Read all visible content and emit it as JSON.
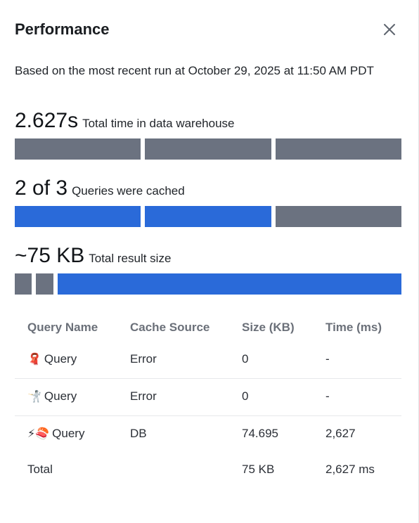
{
  "panel": {
    "title": "Performance",
    "close_icon": "close-icon"
  },
  "subtitle": "Based on the most recent run at October 29, 2025 at 11:50 AM PDT",
  "metrics": {
    "time": {
      "value": "2.627s",
      "label": "Total time in data warehouse",
      "segments": [
        "gray",
        "gray",
        "gray"
      ]
    },
    "cached": {
      "value": "2 of 3",
      "label": "Queries were cached",
      "segments": [
        "blue",
        "blue",
        "gray"
      ]
    },
    "size": {
      "value": "~75 KB",
      "label": "Total result size",
      "segments": [
        "gray",
        "gray",
        "blue"
      ]
    }
  },
  "table": {
    "headers": [
      "Query Name",
      "Cache Source",
      "Size (KB)",
      "Time (ms)"
    ],
    "rows": [
      {
        "emoji": "🧣",
        "name": "Query",
        "source": "Error",
        "size": "0",
        "time": "-"
      },
      {
        "emoji": "🤺",
        "name": "Query",
        "source": "Error",
        "size": "0",
        "time": "-"
      },
      {
        "emoji": "⚡🍣",
        "name": "Query",
        "source": "DB",
        "size": "74.695",
        "time": "2,627"
      }
    ],
    "total": {
      "label": "Total",
      "size": "75 KB",
      "time": "2,627 ms"
    }
  },
  "colors": {
    "bar_gray": "#6b7280",
    "bar_blue": "#2a6ad9"
  }
}
